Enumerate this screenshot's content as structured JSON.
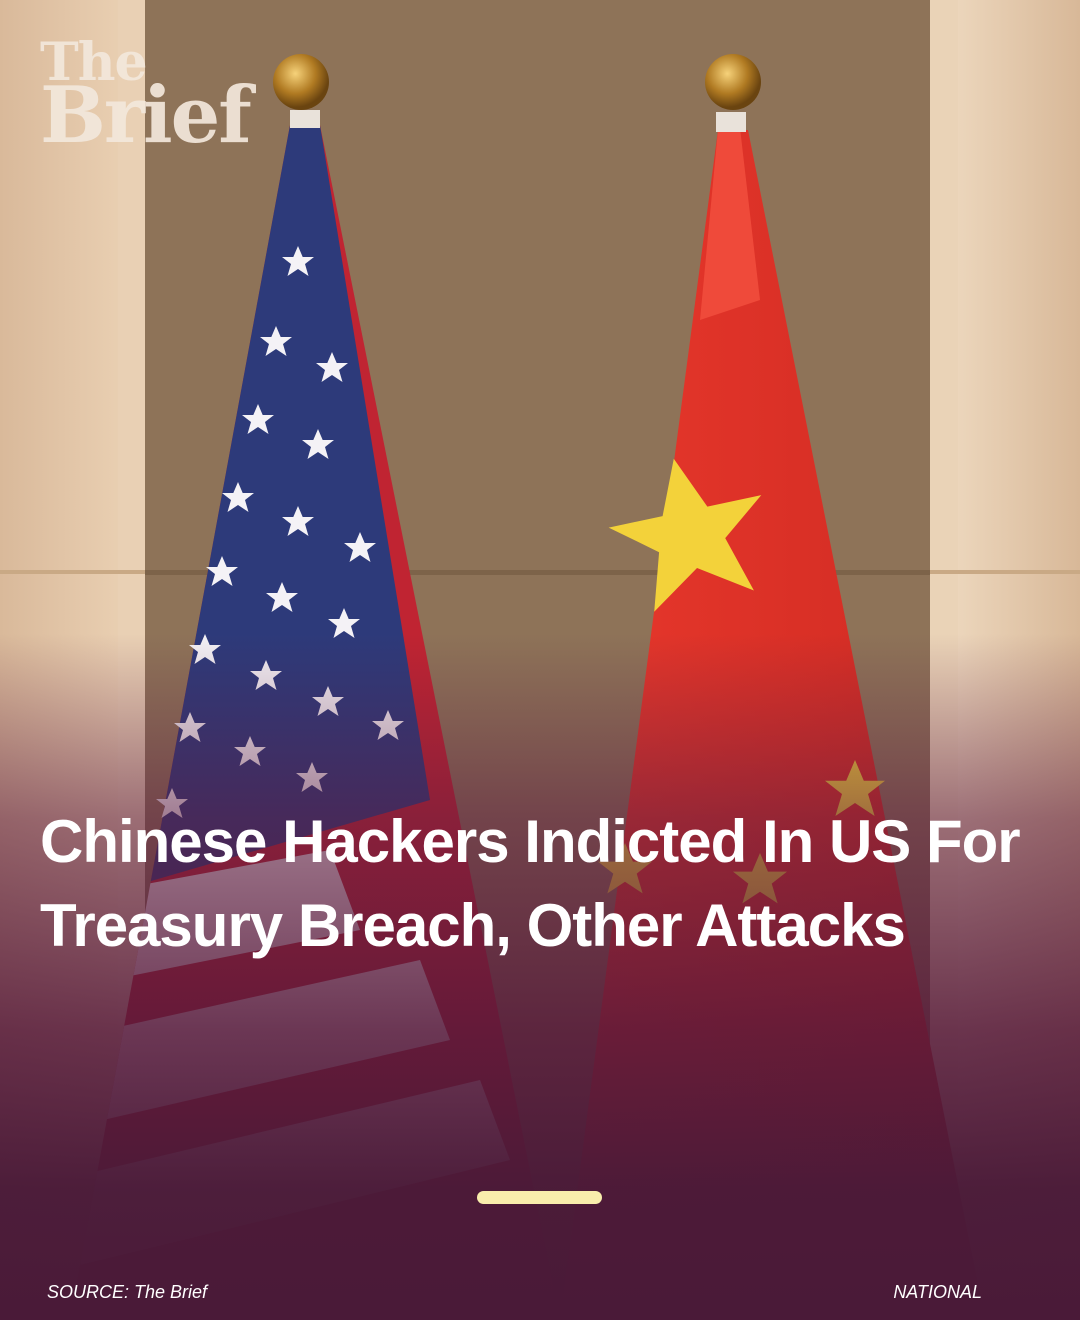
{
  "brand": {
    "logo_line1": "The",
    "logo_line2": "Brief"
  },
  "headline": "Chinese Hackers Indicted In US For Treasury Breach, Other Attacks",
  "footer": {
    "source": "SOURCE: The Brief",
    "category": "NATIONAL"
  },
  "colors": {
    "background": "#4a1a38",
    "progress_bar": "#f9edac",
    "text": "#ffffff"
  }
}
